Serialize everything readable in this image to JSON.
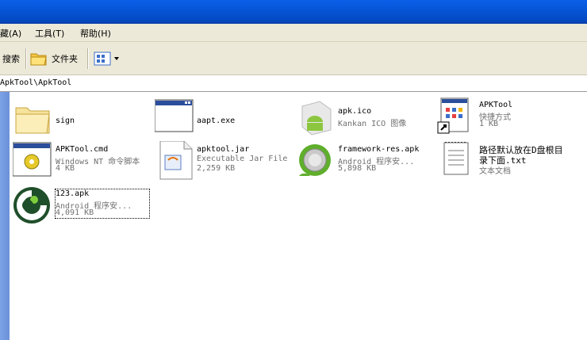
{
  "menu": [
    "藏(A)",
    "工具(T)",
    "帮助(H)"
  ],
  "toolbar": {
    "search_label": "搜索",
    "folders_label": "文件夹"
  },
  "address": "ApkTool\\ApkTool",
  "files": [
    {
      "name": "sign",
      "type": "",
      "size": ""
    },
    {
      "name": "aapt.exe",
      "type": "",
      "size": ""
    },
    {
      "name": "apk.ico",
      "type": "Kankan ICO 图像",
      "size": ""
    },
    {
      "name": "APKTool",
      "type": "快捷方式",
      "size": "1 KB"
    },
    {
      "name": "APKTool.cmd",
      "type": "Windows NT 命令脚本",
      "size": "4 KB"
    },
    {
      "name": "apktool.jar",
      "type": "Executable Jar File",
      "size": "2,259 KB"
    },
    {
      "name": "framework-res.apk",
      "type": "Android 程序安...",
      "size": "5,898 KB"
    },
    {
      "name": "路径默认放在D盘根目",
      "name2": "录下面.txt",
      "type": "文本文档",
      "size": ""
    },
    {
      "name": "123.apk",
      "type": "Android 程序安...",
      "size": "4,091 KB"
    }
  ],
  "colors": {
    "title_bar": "#0756d8",
    "menu_bar": "#ece9d8",
    "left_pane": "#7ba2e7"
  }
}
